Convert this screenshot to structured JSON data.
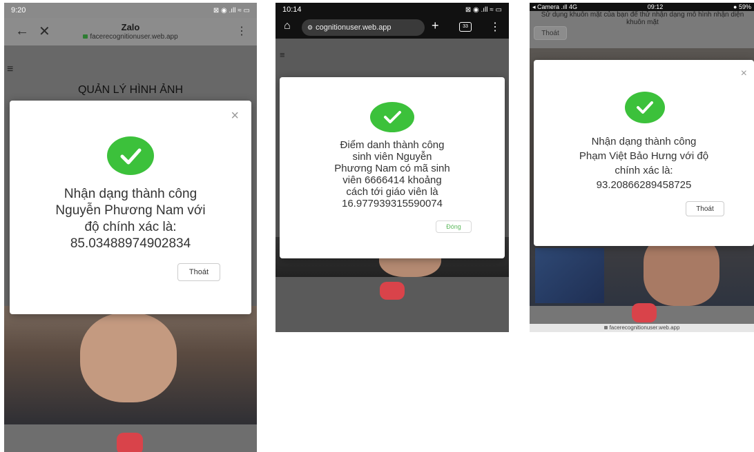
{
  "phone1": {
    "status_time": "9:20",
    "status_icons": "⊠ ◉ .ıll ≈ ▭",
    "browser_title": "Zalo",
    "browser_url": "facerecognitionuser.web.app",
    "page_heading": "QUẢN LÝ HÌNH ẢNH",
    "modal_message": "Nhận dạng thành công\nNguyễn Phương Nam với\nđộ chính xác là:\n85.03488974902834",
    "exit_button": "Thoát"
  },
  "phone2": {
    "status_time": "10:14",
    "status_icons": "⊠ ◉ .ıll ≈ ▭",
    "url": "cognitionuser.web.app",
    "tab_count": "33",
    "modal_message": "Điểm danh thành công\nsinh viên Nguyễn\nPhương Nam có mã sinh\nviên 6666414 khoảng\ncách tới giáo viên là\n16.977939315590074",
    "close_button": "Đóng"
  },
  "phone3": {
    "status_carrier": "◂ Camera .ıll 4G",
    "status_time": "09:12",
    "status_battery": "● 59%",
    "top_text": "Sử dụng khuôn mặt của bạn để thử nhận dạng mô hình nhận diện khuôn mặt",
    "top_exit_button": "Thoát",
    "modal_message": "Nhận dạng thành công\nPhạm Việt Bảo Hưng với độ\nchính xác là:\n93.20866289458725",
    "exit_button": "Thoát",
    "bottom_url": "facerecognitionuser.web.app"
  },
  "colors": {
    "success_green": "#3cc13b",
    "record_red": "#d9434a"
  }
}
